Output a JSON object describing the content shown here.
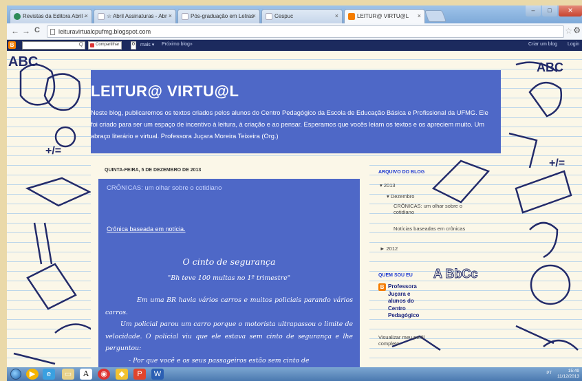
{
  "browser": {
    "tabs": [
      {
        "label": "Revistas da Editora Abril -",
        "favicon_color": "#2e8b57",
        "close": "×",
        "active": false
      },
      {
        "label": "☆ Abril Assinaturas - Abr",
        "favicon_color": "#cfd8e4",
        "close": "×",
        "active": false
      },
      {
        "label": "Pós-graduação em Letras",
        "favicon_color": "#cfd8e4",
        "close": "×",
        "active": false
      },
      {
        "label": "Cespuc",
        "favicon_color": "#cfd8e4",
        "close": "×",
        "active": false
      },
      {
        "label": "LEITUR@ VIRTU@L",
        "favicon_color": "#f57d00",
        "close": "×",
        "active": true
      }
    ],
    "window_controls": {
      "minimize": "–",
      "maximize": "□",
      "close": "✕"
    },
    "nav": {
      "back": "←",
      "forward": "→",
      "reload": "C"
    },
    "url": "leituravirtualcpufmg.blogspot.com",
    "star_icon": "☆",
    "wrench_icon": "⚙"
  },
  "blogger_navbar": {
    "logo": "B",
    "search_icon": "Q",
    "share_label": "Compartilhar",
    "share_count": "0",
    "more_label": "mais ▾",
    "next_blog": "Próximo blog»",
    "create_blog": "Criar um blog",
    "login": "Login"
  },
  "header": {
    "title": "LEITUR@ VIRTU@L",
    "description": "Neste blog, publicaremos os textos criados pelos alunos do Centro Pedagógico da Escola de Educação Básica e Profissional da UFMG. Ele foi criado para ser um espaço de incentivo à leitura, à criação e ao pensar. Esperamos que vocês leiam os textos e os apreciem muito. Um abraço literário e virtual. Professora Juçara Moreira Teixeira (Org.)"
  },
  "post": {
    "date": "QUINTA-FEIRA, 5 DE DEZEMBRO DE 2013",
    "title": "CRÔNICAS: um olhar sobre o cotidiano",
    "link": "Crônica baseada em notícia.",
    "story_title": "O cinto de segurança",
    "story_subtitle": "\"Bh teve 100 multas no 1º trimestre\"",
    "paragraphs": [
      "Em uma BR havia vários carros e muitos policiais parando vários carros.",
      "Um policial parou um carro porque o motorista ultrapassou o limite de velocidade. O policial viu que ele estava sem cinto de segurança e lhe perguntou:",
      "- Por que você e os seus passageiros estão sem cinto de"
    ]
  },
  "sidebar": {
    "archive_heading": "ARQUIVO DO BLOG",
    "year_2013": "▾ 2013",
    "month": "▾ Dezembro",
    "archive_post_1": "CRÔNICAS: um olhar sobre o cotidiano",
    "archive_post_2": "Notícias baseadas em crônicas",
    "year_2012": "► 2012",
    "about_heading": "QUEM SOU EU",
    "profile_icon": "B",
    "profile_name": "Professora Juçara e alunos do Centro Pedagógico",
    "profile_link": "Visualizar meu perfil completo"
  },
  "taskbar": {
    "language": "PT",
    "time": "15:49",
    "date": "11/12/2013"
  },
  "colors": {
    "blog_blue": "#4e68c7",
    "navbar_navy": "#1c2a5e",
    "blogger_orange": "#f57d00"
  }
}
